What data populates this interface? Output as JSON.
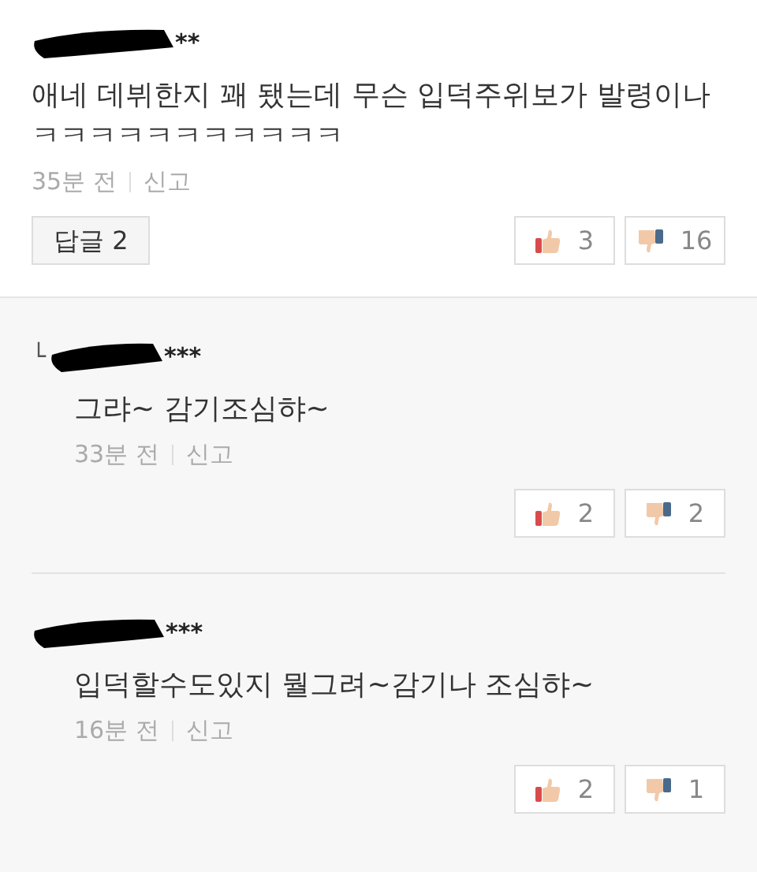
{
  "comment": {
    "author": "**",
    "text": "애네 데뷔한지 꽤 됐는데 무슨 입덕주위보가 발령이나 ㅋㅋㅋㅋㅋㅋㅋㅋㅋㅋㅋ",
    "time": "35분 전",
    "report": "신고",
    "reply_button": "답글 2",
    "likes": "3",
    "dislikes": "16"
  },
  "replies": [
    {
      "marker": "└",
      "author": "***",
      "text": "그랴~ 감기조심햐~",
      "time": "33분 전",
      "report": "신고",
      "likes": "2",
      "dislikes": "2"
    },
    {
      "author": "***",
      "text": "입덕할수도있지 뭘그려~감기나 조심햐~",
      "time": "16분 전",
      "report": "신고",
      "likes": "2",
      "dislikes": "1"
    }
  ]
}
